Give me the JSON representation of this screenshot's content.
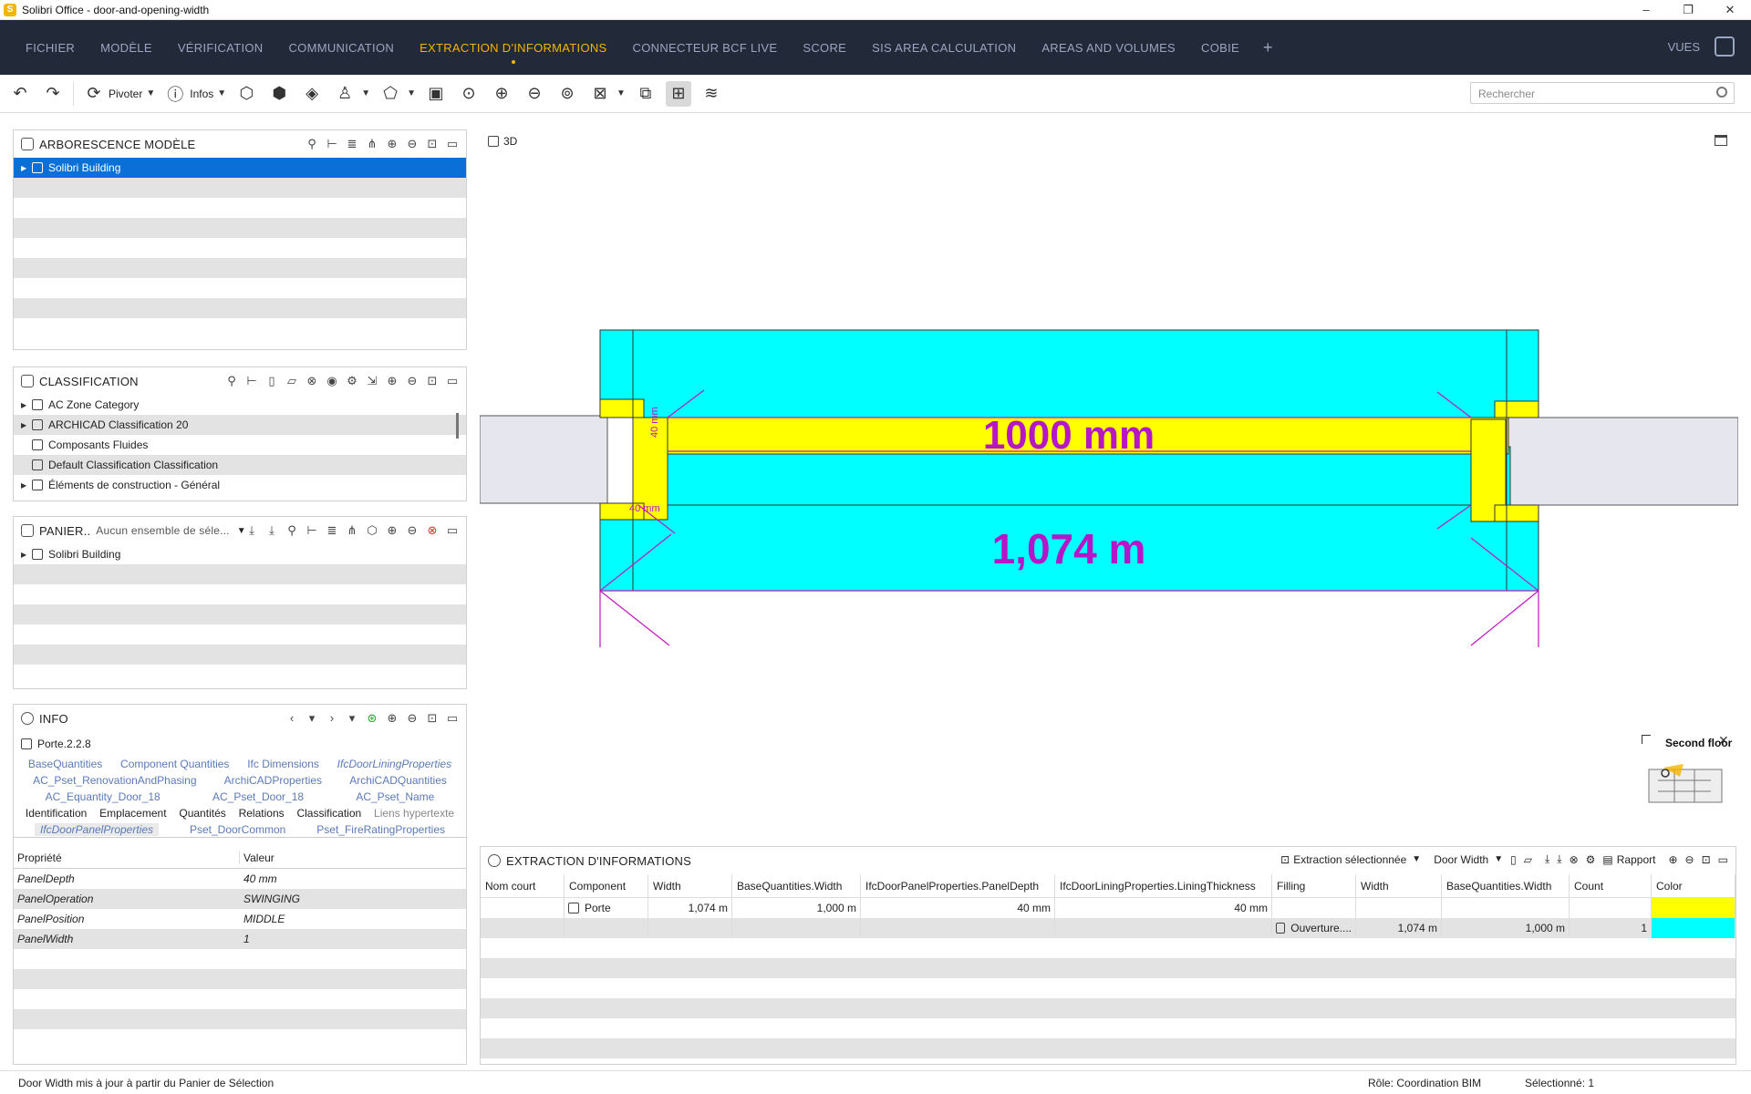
{
  "window": {
    "title": "Solibri Office - door-and-opening-width",
    "logo": "S",
    "controls": [
      "–",
      "❐",
      "✕"
    ]
  },
  "menu": {
    "items": [
      "FICHIER",
      "MODÈLE",
      "VÉRIFICATION",
      "COMMUNICATION",
      "EXTRACTION D'INFORMATIONS",
      "CONNECTEUR BCF LIVE",
      "SCORE",
      "SIS AREA CALCULATION",
      "AREAS AND VOLUMES",
      "COBIE"
    ],
    "active": "EXTRACTION D'INFORMATIONS",
    "plus": "+",
    "vues": "VUES"
  },
  "toolbar": {
    "pivot_label": "Pivoter",
    "info_label": "Infos",
    "search_placeholder": "Rechercher"
  },
  "model_tree": {
    "title": "ARBORESCENCE MODÈLE",
    "items": [
      {
        "label": "Solibri Building"
      }
    ]
  },
  "classification": {
    "title": "CLASSIFICATION",
    "items": [
      {
        "label": "AC Zone Category",
        "expand": "▶"
      },
      {
        "label": "ARCHICAD Classification 20",
        "expand": "▶"
      },
      {
        "label": "Composants Fluides",
        "expand": ""
      },
      {
        "label": "Default Classification Classification",
        "expand": ""
      },
      {
        "label": "Éléments de construction - Général",
        "expand": "▶"
      }
    ]
  },
  "basket": {
    "title": "PANIER..",
    "selector": "Aucun ensemble de séle...",
    "items": [
      {
        "label": "Solibri Building"
      }
    ]
  },
  "info": {
    "title": "INFO",
    "object_name": "Porte.2.2.8",
    "tabs_row1": [
      "BaseQuantities",
      "Component Quantities",
      "Ifc Dimensions",
      "IfcDoorLiningProperties"
    ],
    "tabs_row2": [
      "AC_Pset_RenovationAndPhasing",
      "ArchiCADProperties",
      "ArchiCADQuantities"
    ],
    "tabs_row3": [
      "AC_Equantity_Door_18",
      "AC_Pset_Door_18",
      "AC_Pset_Name"
    ],
    "tabs_row4": [
      "Identification",
      "Emplacement",
      "Quantités",
      "Relations",
      "Classification",
      "Liens hypertexte"
    ],
    "tabs_row5": [
      "IfcDoorPanelProperties",
      "Pset_DoorCommon",
      "Pset_FireRatingProperties"
    ],
    "col_property": "Propriété",
    "col_value": "Valeur",
    "properties": [
      {
        "k": "PanelDepth",
        "v": "40 mm"
      },
      {
        "k": "PanelOperation",
        "v": "SWINGING"
      },
      {
        "k": "PanelPosition",
        "v": "MIDDLE"
      },
      {
        "k": "PanelWidth",
        "v": "1"
      }
    ]
  },
  "viewport": {
    "label": "3D",
    "dim_door": "1000 mm",
    "dim_opening": "1,074 m",
    "dim_small_1": "40 mm",
    "dim_small_2": "40 mm",
    "minimap_label": "Second floor",
    "colors": {
      "opening": "#00ffff",
      "door": "#ffff00",
      "dimension": "#c018c0",
      "wall": "#e6e6ee"
    }
  },
  "extraction": {
    "title": "EXTRACTION D'INFORMATIONS",
    "mode": "Extraction sélectionnée",
    "layout": "Door Width",
    "report": "Rapport",
    "columns": [
      "Nom court",
      "Component",
      "Width",
      "BaseQuantities.Width",
      "IfcDoorPanelProperties.PanelDepth",
      "IfcDoorLiningProperties.LiningThickness",
      "Filling",
      "Width",
      "BaseQuantities.Width",
      "Count",
      "Color"
    ],
    "rows": [
      {
        "nom": "",
        "component": "Porte",
        "width": "1,074 m",
        "bq_width": "1,000 m",
        "panel_depth": "40 mm",
        "lining": "40 mm",
        "filling": "",
        "width2": "",
        "bq_width2": "",
        "count": "",
        "color": "#ffff00"
      },
      {
        "nom": "",
        "component": "",
        "width": "",
        "bq_width": "",
        "panel_depth": "",
        "lining": "",
        "filling": "Ouverture....",
        "width2": "1,074 m",
        "bq_width2": "1,000 m",
        "count": "1",
        "color": "#00ffff"
      }
    ]
  },
  "status": {
    "message": "Door Width mis à jour à partir du Panier de Sélection",
    "role": "Rôle: Coordination BIM",
    "selected": "Sélectionné: 1"
  }
}
